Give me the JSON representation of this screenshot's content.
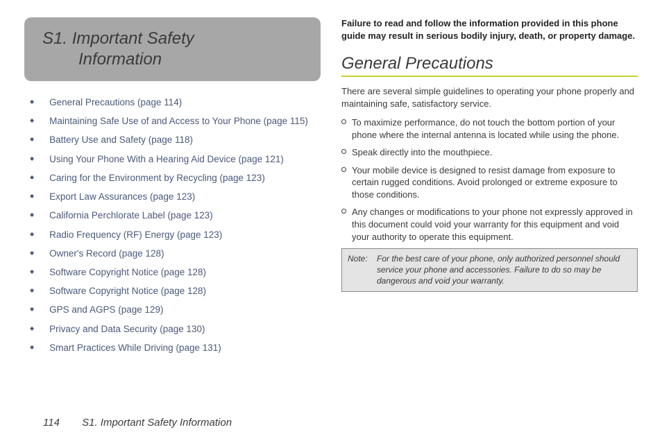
{
  "section": {
    "prefix": "S1.",
    "title_line1": "S1. Important Safety",
    "title_line2": "Information"
  },
  "toc": [
    {
      "text": "General Precautions (page 114)"
    },
    {
      "text": "Maintaining Safe Use of and Access to Your Phone (page 115)"
    },
    {
      "text": "Battery Use and Safety (page 118)"
    },
    {
      "text": "Using Your Phone With a Hearing Aid Device (page 121)"
    },
    {
      "text": "Caring for the Environment by Recycling (page 123)"
    },
    {
      "text": "Export Law Assurances (page 123)"
    },
    {
      "text": "California Perchlorate Label (page 123)"
    },
    {
      "text": "Radio Frequency (RF) Energy (page 123)"
    },
    {
      "text": "Owner's Record (page 128)"
    },
    {
      "text": "Software Copyright Notice (page 128)"
    },
    {
      "text": "Software Copyright Notice (page 128)"
    },
    {
      "text": "GPS and AGPS (page 129)"
    },
    {
      "text": "Privacy and Data Security (page 130)"
    },
    {
      "text": "Smart Practices While Driving (page 131)"
    }
  ],
  "right": {
    "warning": "Failure to read and follow the information provided in this phone guide may result in serious bodily injury, death, or property damage.",
    "heading": "General Precautions",
    "intro": "There are several simple guidelines to operating your phone properly and maintaining safe, satisfactory service.",
    "bullets": [
      "To maximize performance, do not touch the bottom portion of your phone where the internal antenna is located while using the phone.",
      "Speak directly into the mouthpiece.",
      "Your mobile device is designed to resist damage from exposure to certain rugged conditions. Avoid prolonged or extreme exposure to those conditions.",
      "Any changes or modifications to your phone not expressly approved in this document could void your warranty for this equipment and void your authority to operate this equipment."
    ],
    "note_label": "Note:",
    "note_text": "For the best care of your phone, only authorized personnel should service your phone and accessories. Failure to do so may be dangerous and void your warranty."
  },
  "footer": {
    "page": "114",
    "title": "S1. Important Safety Information"
  }
}
